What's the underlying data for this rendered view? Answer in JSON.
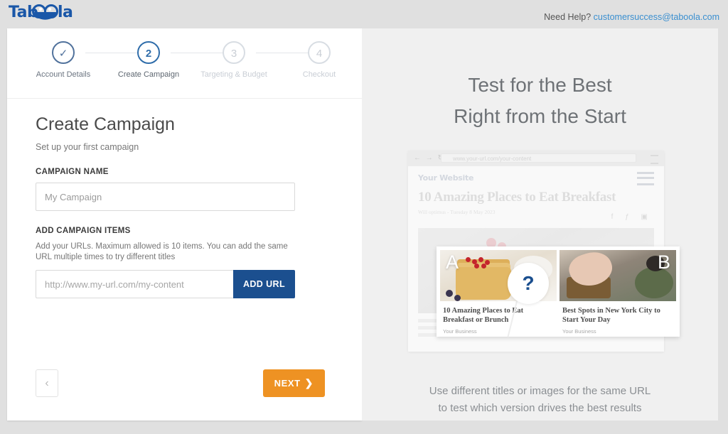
{
  "header": {
    "logo_text": "Taboola",
    "logo_icon": "taboola-smile-logo",
    "help_prefix": "Need Help? ",
    "help_email": "customersuccess@taboola.com"
  },
  "wizard": {
    "steps": [
      {
        "badge": "✓",
        "label": "Account Details",
        "state": "done"
      },
      {
        "badge": "2",
        "label": "Create Campaign",
        "state": "active"
      },
      {
        "badge": "3",
        "label": "Targeting & Budget",
        "state": "inactive"
      },
      {
        "badge": "4",
        "label": "Checkout",
        "state": "inactive"
      }
    ]
  },
  "form": {
    "title": "Create Campaign",
    "subtitle": "Set up your first campaign",
    "campaign_name_label": "CAMPAIGN NAME",
    "campaign_name_value": "My Campaign",
    "campaign_name_placeholder": "My Campaign",
    "campaign_items_label": "ADD CAMPAIGN ITEMS",
    "campaign_items_helper": "Add your URLs. Maximum allowed is 10 items. You can add the same URL multiple times to try different titles",
    "url_placeholder": "http://www.my-url.com/my-content",
    "url_value": "",
    "add_url_label": "ADD URL"
  },
  "nav": {
    "back_icon": "‹",
    "next_label": "NEXT",
    "next_chevron": "❯"
  },
  "promo": {
    "title_line1": "Test for the Best",
    "title_line2": "Right from the Start",
    "caption_line1": "Use different titles or images for the same URL",
    "caption_line2": "to test which version drives the best results"
  },
  "illustration": {
    "browser_nav_icons": "← → ↻",
    "browser_url": "www.your-url.com/your-content",
    "site_name": "Your Website",
    "article_title": "10 Amazing Places to Eat Breakfast",
    "article_meta": "Will optimus  -  Tuesday 8 May 2023",
    "social_icons": "f ƒ ▣",
    "question_mark": "?",
    "cards": [
      {
        "letter": "A",
        "title": "10 Amazing Places to Eat Breakfast or Brunch",
        "brand": "Your Business"
      },
      {
        "letter": "B",
        "title": "Best Spots in New York City to Start Your Day",
        "brand": "Your Business"
      }
    ]
  },
  "colors": {
    "brand_blue": "#1b4f8f",
    "accent_orange": "#ee9223",
    "page_bg": "#e0e0e0",
    "panel_bg": "#f0f0f0",
    "link_blue": "#3a8fd0"
  }
}
